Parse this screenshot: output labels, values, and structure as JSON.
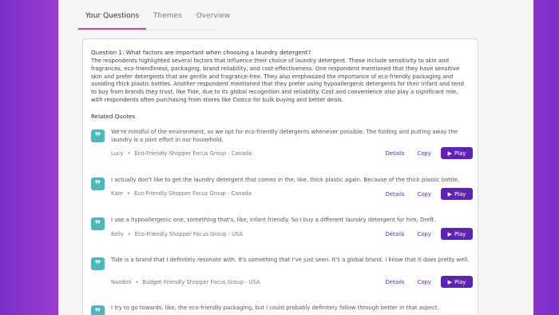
{
  "tabs": [
    {
      "label": "Your Questions",
      "active": true
    },
    {
      "label": "Themes",
      "active": false
    },
    {
      "label": "Overview",
      "active": false
    }
  ],
  "question": {
    "title": "Question 1: What factors are important when choosing a laundry detergent?",
    "answer": "The respondents highlighted several factors that influence their choice of laundry detergent. These include sensitivity to skin and fragrances, eco-friendliness, packaging, brand reliability, and cost-effectiveness. One respondent mentioned that they have sensitive skin and prefer detergents that are gentle and fragrance-free. They also emphasized the importance of eco-friendly packaging and avoiding thick plastic bottles. Another respondent mentioned that they prefer using hypoallergenic detergents for their infant and tend to buy from brands they trust, like Tide, due to its global recognition and reliability. Cost and convenience also play a significant role, with respondents often purchasing from stores like Costco for bulk buying and better deals."
  },
  "related_quotes_title": "Related Quotes",
  "actions": {
    "details": "Details",
    "copy": "Copy",
    "play": "Play"
  },
  "quotes": [
    {
      "text": "We're mindful of the environment, so we opt for eco-friendly detergents whenever possible. The folding and putting away the laundry is a joint effort in our household.",
      "speaker": "Lucy",
      "group": "Eco-Friendly Shopper Focus Group - Canada"
    },
    {
      "text": "I actually don't like to get the laundry detergent that comes in the, like, thick plastic again. Because of the thick plastic bottle.",
      "speaker": "Kate",
      "group": "Eco-Friendly Shopper Focus Group - Canada"
    },
    {
      "text": "I use a hypoallergenic one, something that's, like, infant friendly. So I buy a different laundry detergent for him, Dreft.",
      "speaker": "Kelly",
      "group": "Eco-Friendly Shopper Focus Group - USA"
    },
    {
      "text": "Tide is a brand that I definitely resonate with. It's something that I've just seen. It's a global brand. I know that it does pretty well.",
      "speaker": "Nandini",
      "group": "Budget-Friendly Shopper Focus Group - USA"
    },
    {
      "text": "I try to go towards, like, the eco-friendly packaging, but I could probably definitely follow through better in that aspect.",
      "speaker": "",
      "group": ""
    }
  ],
  "colors": {
    "accent": "#5f22b6",
    "tab_indicator": "#d64a86",
    "quote_icon": "#4fb6b9"
  },
  "icons": {
    "quote": "quote-icon",
    "play": "play-icon"
  }
}
